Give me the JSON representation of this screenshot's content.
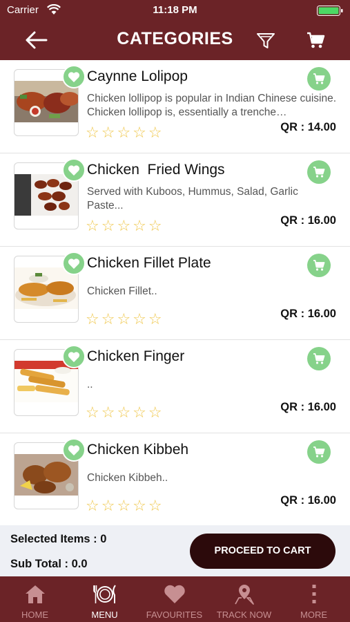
{
  "status_bar": {
    "carrier": "Carrier",
    "time": "11:18 PM"
  },
  "header": {
    "title": "CATEGORIES"
  },
  "items": [
    {
      "name": "Caynne Lolipop",
      "description": "Chicken lollipop is popular in Indian Chinese cuisine. Chicken lollipop is, essentially a trenche…",
      "price": "QR : 14.00",
      "rating": 0,
      "stars": "☆☆☆☆☆"
    },
    {
      "name": "Chicken  Fried Wings",
      "description": "Served with Kuboos, Hummus, Salad, Garlic Paste...",
      "price": "QR : 16.00",
      "rating": 0,
      "stars": "☆☆☆☆☆"
    },
    {
      "name": "Chicken Fillet Plate",
      "description": "Chicken Fillet..",
      "price": "QR : 16.00",
      "rating": 0,
      "stars": "☆☆☆☆☆"
    },
    {
      "name": "Chicken Finger",
      "description": "..",
      "price": "QR : 16.00",
      "rating": 0,
      "stars": "☆☆☆☆☆"
    },
    {
      "name": "Chicken Kibbeh",
      "description": "Chicken Kibbeh..",
      "price": "QR : 16.00",
      "rating": 0,
      "stars": "☆☆☆☆☆"
    }
  ],
  "summary": {
    "selected_items": "Selected Items : 0",
    "sub_total": "Sub Total : 0.0",
    "proceed_label": "PROCEED TO CART"
  },
  "tabs": [
    {
      "label": "HOME",
      "icon": "home-icon",
      "active": false
    },
    {
      "label": "MENU",
      "icon": "menu-plate-icon",
      "active": true
    },
    {
      "label": "FAVOURITES",
      "icon": "heart-icon",
      "active": false
    },
    {
      "label": "TRACK NOW",
      "icon": "map-pin-icon",
      "active": false
    },
    {
      "label": "MORE",
      "icon": "more-vertical-icon",
      "active": false
    }
  ],
  "colors": {
    "brand": "#6b2327",
    "accent_green": "#86d28a",
    "star": "#efc648",
    "button_dark": "#2c0a0b",
    "summary_bg": "#eef0f5"
  }
}
